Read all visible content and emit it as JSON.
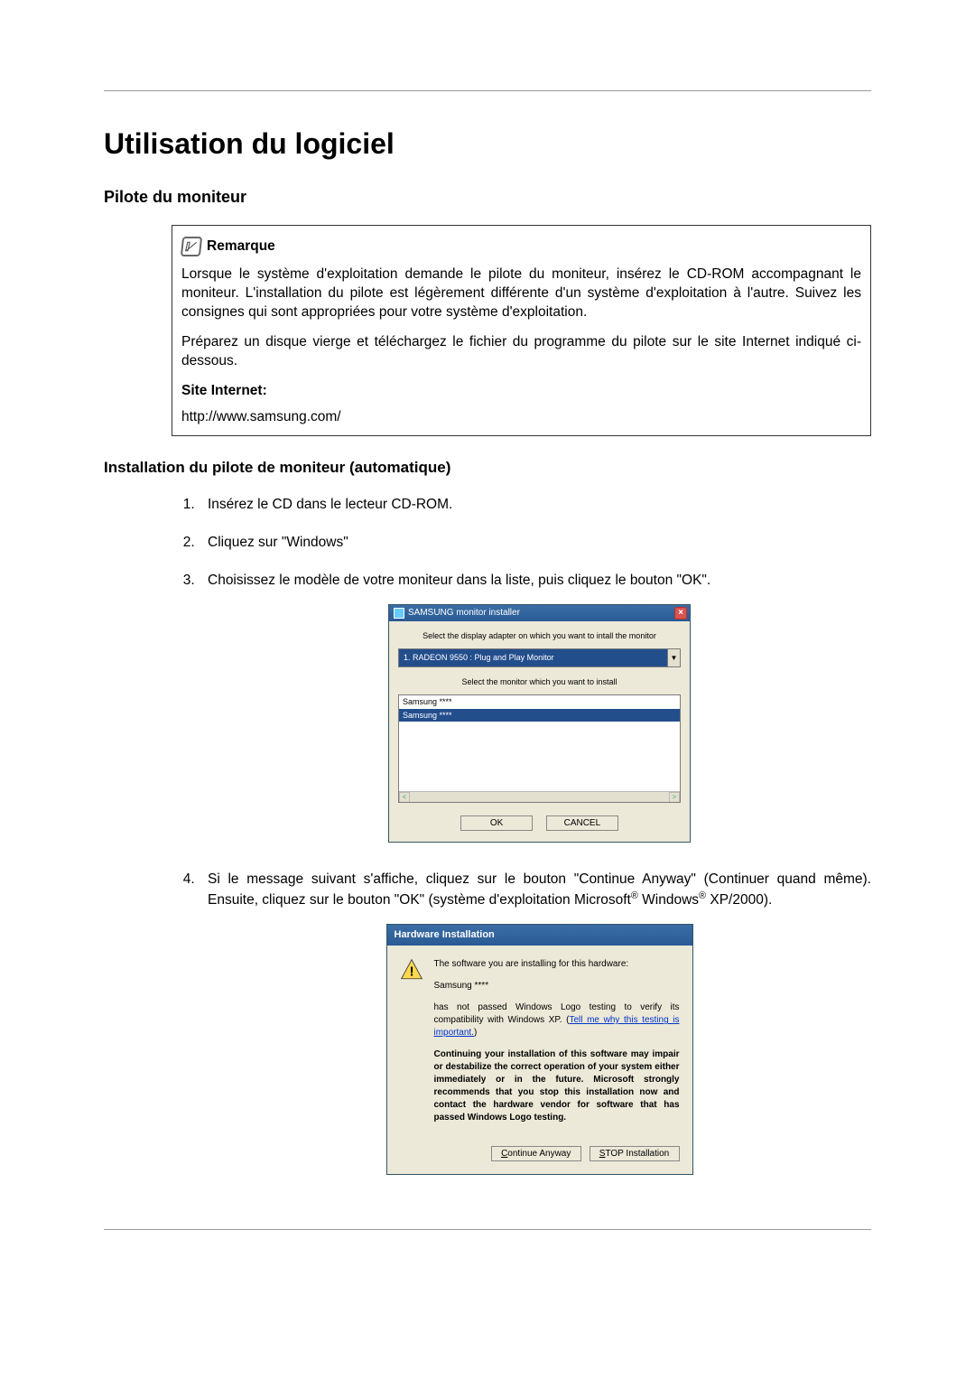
{
  "page_title": "Utilisation du logiciel",
  "section_driver": "Pilote du moniteur",
  "note": {
    "label": "Remarque",
    "para1": "Lorsque le système d'exploitation demande le pilote du moniteur, insérez le CD-ROM accompagnant le moniteur. L'installation du pilote est légèrement différente d'un système d'exploitation à l'autre. Suivez les consignes qui sont appropriées pour votre système d'exploitation.",
    "para2": "Préparez un disque vierge et téléchargez le fichier du programme du pilote sur le site Internet indiqué ci-dessous.",
    "site_label": "Site Internet:",
    "site_url": "http://www.samsung.com/"
  },
  "section_install": "Installation du pilote de moniteur (automatique)",
  "steps": {
    "s1": "Insérez le CD dans le lecteur CD-ROM.",
    "s2": "Cliquez sur \"Windows\"",
    "s3": "Choisissez le modèle de votre moniteur dans la liste, puis cliquez le bouton \"OK\".",
    "s4_a": "Si le message suivant s'affiche, cliquez sur le bouton \"Continue Anyway\" (Continuer quand même). Ensuite, cliquez sur le bouton \"OK\" (système d'exploitation Microsoft",
    "s4_b": " Windows",
    "s4_c": " XP/2000)."
  },
  "dlg1": {
    "title": "SAMSUNG monitor installer",
    "label_adapter": "Select the display adapter on which you want to intall the monitor",
    "adapter_selected": "1. RADEON 9550 : Plug and Play Monitor",
    "label_monitor": "Select the monitor which you want to install",
    "list_item_0": "Samsung ****",
    "list_item_1": "Samsung ****",
    "btn_ok": "OK",
    "btn_cancel": "CANCEL"
  },
  "dlg2": {
    "title": "Hardware Installation",
    "line1": "The software you are installing for this hardware:",
    "line2": "Samsung ****",
    "line3_a": "has not passed Windows Logo testing to verify its compatibility with Windows XP. (",
    "line3_link": "Tell me why this testing is important.",
    "line3_b": ")",
    "bold_para": "Continuing your installation of this software may impair or destabilize the correct operation of your system either immediately or in the future. Microsoft strongly recommends that you stop this installation now and contact the hardware vendor for software that has passed Windows Logo testing.",
    "btn_continue": "Continue Anyway",
    "btn_stop": "STOP Installation"
  }
}
